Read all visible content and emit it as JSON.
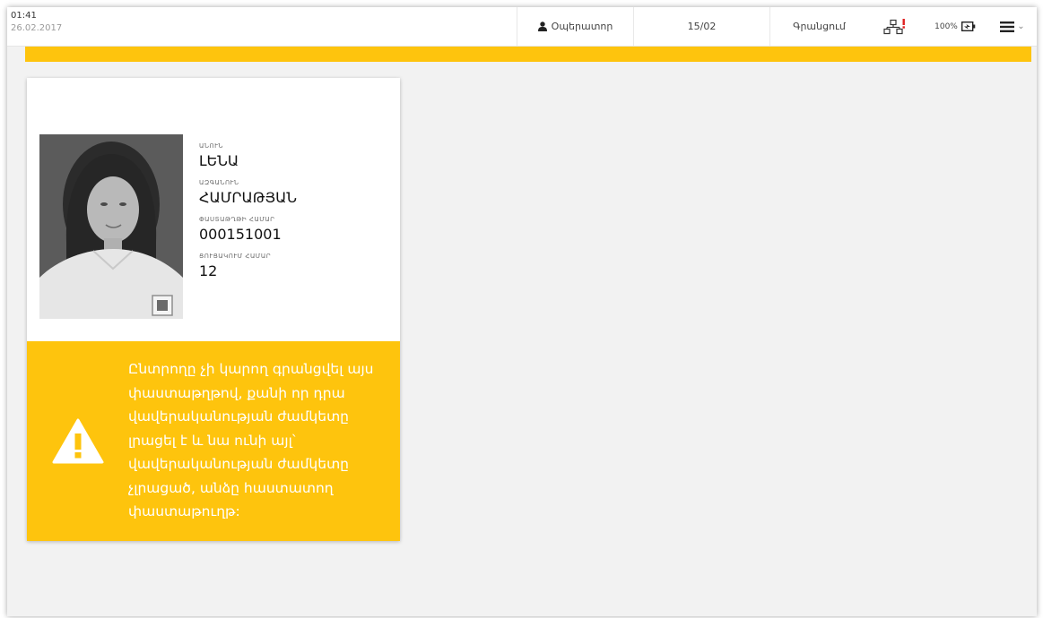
{
  "status_bar": {
    "time": "01:41",
    "date": "26.02.2017",
    "operator_label": "Օպերատոր",
    "station": "15/02",
    "register_label": "Գրանցում",
    "battery": "100%"
  },
  "voter": {
    "first_name_label": "ԱՆՈՒՆ",
    "first_name": "ԼԵՆԱ",
    "last_name_label": "ԱԶԳԱՆՈՒՆ",
    "last_name": "ՀԱՄՐԱԹՅԱՆ",
    "document_label": "ՓԱՍՏԱԹՂԹԻ ՀԱՄԱՐ",
    "document_number": "000151001",
    "list_label": "ՑՈՒՑԱԿՈՒՄ ՀԱՄԱՐ",
    "list_number": "12"
  },
  "warning": {
    "message": "Ընտրողը չի կարող գրանցվել այս փաստաթղթով, քանի որ դրա վավերականության ժամկետը լրացել է և նա ունի այլ՝ վավերականության ժամկետը չլրացած, անձը հաստատող փաստաթուղթ:"
  },
  "icons": {
    "operator": "user-icon",
    "network": "network-error-icon",
    "battery": "battery-charging-icon",
    "menu": "hamburger-menu-icon",
    "warning": "warning-triangle-icon"
  },
  "colors": {
    "accent": "#fec40d",
    "alert_red": "#e02020",
    "background": "#f2f2f2"
  }
}
